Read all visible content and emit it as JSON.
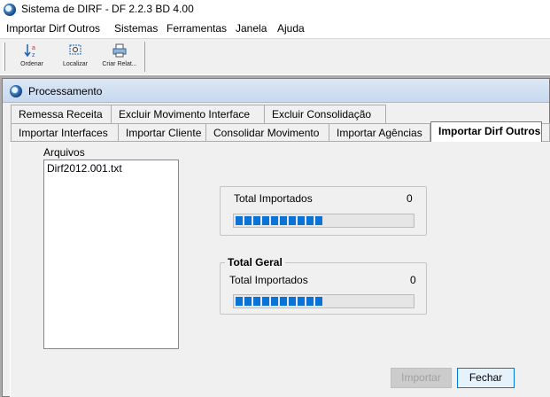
{
  "window": {
    "title": "Sistema de DIRF -  DF 2.2.3 BD 4.00"
  },
  "menu": {
    "items": [
      "Importar Dirf Outros",
      "Sistemas",
      "Ferramentas",
      "Janela",
      "Ajuda"
    ]
  },
  "toolbar": {
    "buttons": [
      {
        "label": "Ordenar",
        "icon": "sort-az-icon"
      },
      {
        "label": "Localizar",
        "icon": "find-icon"
      },
      {
        "label": "Criar Relat...",
        "icon": "printer-icon"
      }
    ]
  },
  "child": {
    "title": "Processamento",
    "tabs_back": [
      "Remessa Receita",
      "Excluir  Movimento Interface",
      "Excluir  Consolidação"
    ],
    "tabs_front": [
      "Importar Interfaces",
      "Importar Cliente",
      "Consolidar Movimento",
      "Importar Agências",
      "Importar Dirf Outros"
    ],
    "active_tab": "Importar Dirf Outros"
  },
  "files": {
    "label": "Arquivos",
    "items": [
      "Dirf2012.001.txt"
    ]
  },
  "import_group": {
    "label": "Total Importados",
    "count": "0",
    "progress_percent": 50
  },
  "total_group": {
    "title": "Total Geral",
    "label": "Total Importados",
    "count": "0",
    "progress_percent": 50
  },
  "buttons": {
    "import": "Importar",
    "close": "Fechar"
  },
  "colors": {
    "progress": "#0a74d6",
    "active_default_border": "#0078d7"
  }
}
